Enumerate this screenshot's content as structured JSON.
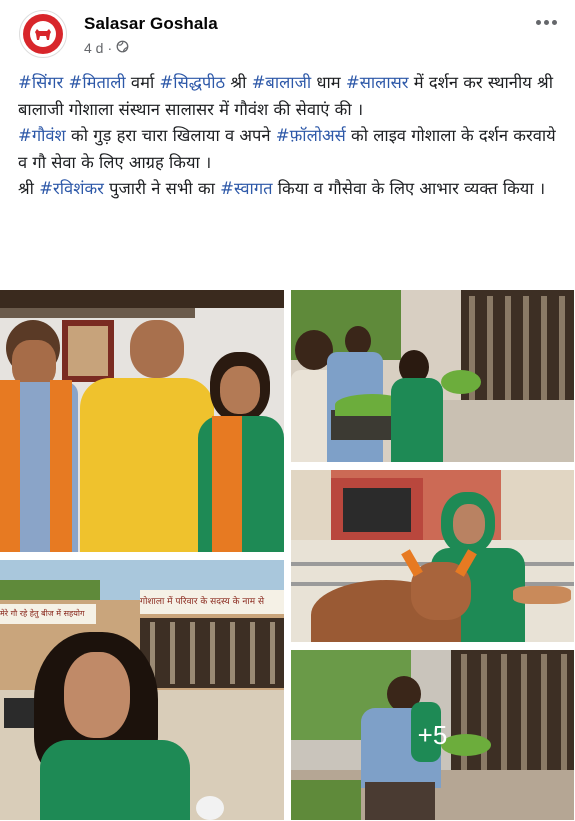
{
  "post": {
    "page_name": "Salasar Goshala",
    "time": "4 d",
    "separator": "·",
    "privacy_icon": "globe-icon",
    "lines": [
      [
        {
          "t": "#सिंगर",
          "tag": true
        },
        {
          "t": " ",
          "tag": false
        },
        {
          "t": "#मिताली",
          "tag": true
        },
        {
          "t": " वर्मा ",
          "tag": false
        },
        {
          "t": "#सिद्धपीठ",
          "tag": true
        },
        {
          "t": " श्री ",
          "tag": false
        },
        {
          "t": "#बालाजी",
          "tag": true
        },
        {
          "t": " धाम ",
          "tag": false
        },
        {
          "t": "#सालासर",
          "tag": true
        },
        {
          "t": " में दर्शन कर स्थानीय श्री बालाजी गोशाला संस्थान सालासर  में  गौवंश की सेवाएं की ।",
          "tag": false
        }
      ],
      [
        {
          "t": "#गौवंश",
          "tag": true
        },
        {
          "t": " को गुड़ हरा चारा खिलाया व अपने ",
          "tag": false
        },
        {
          "t": "#फ़ॉलोअर्स",
          "tag": true
        },
        {
          "t": " को लाइव गोशाला के दर्शन करवाये   व गौ सेवा के लिए आग्रह किया ।",
          "tag": false
        }
      ],
      [
        {
          "t": "श्री ",
          "tag": false
        },
        {
          "t": "#रविशंकर",
          "tag": true
        },
        {
          "t": " पुजारी ने सभी का ",
          "tag": false
        },
        {
          "t": "#स्वागत",
          "tag": true
        },
        {
          "t": " किया  व गौसेवा के लिए आभार व्यक्त किया ।",
          "tag": false
        }
      ]
    ]
  },
  "photos": {
    "more_count": "+5",
    "sign_left": "मेरे गौ रहे हेतु बीज में सहयोग",
    "sign_right": "गोशाला में परिवार के सदस्य के नाम से",
    "sign_note": "..."
  },
  "colors": {
    "hashtag": "#2d58a8",
    "saffron": "#e77a22",
    "green_dress": "#1e8a55",
    "yellow_shirt": "#efc22d",
    "secondary_text": "#65676b"
  }
}
